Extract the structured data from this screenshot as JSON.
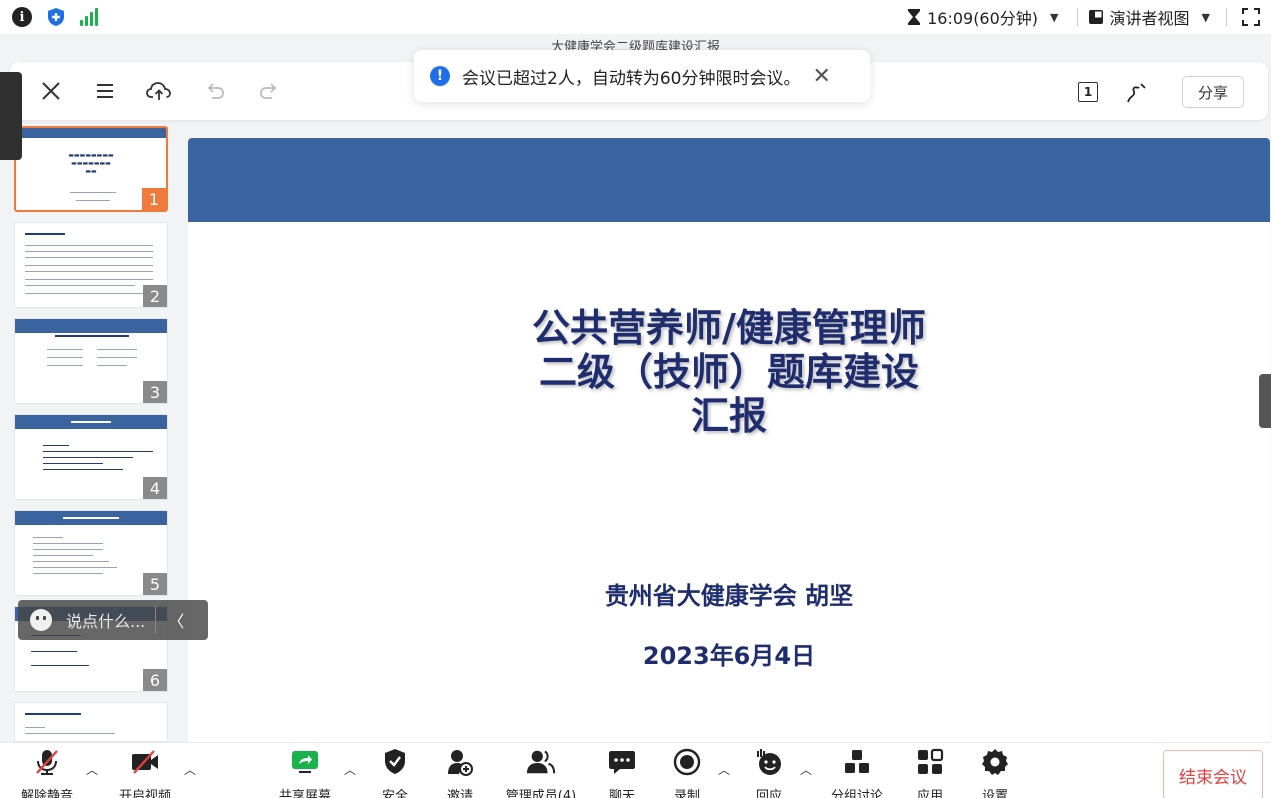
{
  "status_bar": {
    "timer": "16:09(60分钟)",
    "presenter_view": "演讲者视图"
  },
  "document": {
    "title": "大健康学会二级题库建设汇报"
  },
  "toolbar": {
    "page_indicator": "1",
    "share_label": "分享"
  },
  "toast": {
    "message": "会议已超过2人，自动转为60分钟限时会议。"
  },
  "thumbnails": [
    {
      "number": "1",
      "selected": true
    },
    {
      "number": "2",
      "selected": false
    },
    {
      "number": "3",
      "selected": false
    },
    {
      "number": "4",
      "selected": false
    },
    {
      "number": "5",
      "selected": false
    },
    {
      "number": "6",
      "selected": false
    }
  ],
  "slide": {
    "title_line1": "公共营养师/健康管理师",
    "title_line2": "二级（技师）题库建设",
    "title_line3": "汇报",
    "author": "贵州省大健康学会 胡坚",
    "date": "2023年6月4日"
  },
  "chat": {
    "placeholder": "说点什么..."
  },
  "bottom_bar": {
    "unmute": "解除静音",
    "start_video": "开启视频",
    "share_screen": "共享屏幕",
    "security": "安全",
    "invite": "邀请",
    "manage_members": "管理成员(4)",
    "chat": "聊天",
    "record": "录制",
    "reactions": "回应",
    "breakout": "分组讨论",
    "apps": "应用",
    "settings": "设置",
    "end_meeting": "结束会议"
  },
  "colors": {
    "slide_band": "#3a64a0",
    "slide_text": "#1f2d6e",
    "selected_thumb": "#f07a3c",
    "toast_icon": "#1e6fe8",
    "end_button": "#e04040",
    "signal": "#19b24b"
  }
}
